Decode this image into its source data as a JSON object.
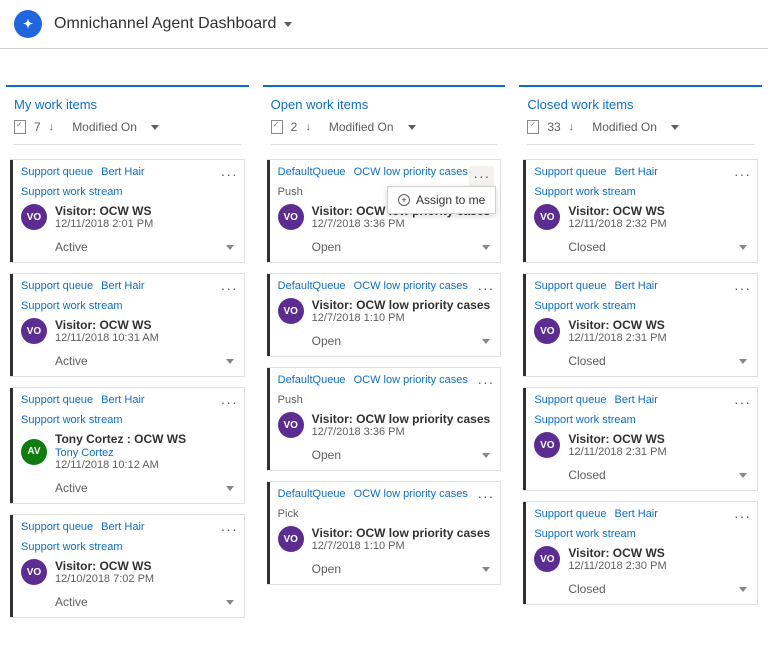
{
  "header": {
    "icon_glyph": "✦",
    "title": "Omnichannel Agent Dashboard"
  },
  "columns": [
    {
      "title": "My work items",
      "count": "7",
      "sort": "Modified On",
      "cards": [
        {
          "tags": [
            {
              "text": "Support queue",
              "kind": "link"
            },
            {
              "text": "Bert Hair",
              "kind": "link"
            },
            {
              "text": "Support work stream",
              "kind": "link"
            }
          ],
          "avatar": {
            "text": "VO",
            "cls": "av-vo"
          },
          "title": "Visitor: OCW WS",
          "date": "12/11/2018 2:01 PM",
          "status": "Active"
        },
        {
          "tags": [
            {
              "text": "Support queue",
              "kind": "link"
            },
            {
              "text": "Bert Hair",
              "kind": "link"
            },
            {
              "text": "Support work stream",
              "kind": "link"
            }
          ],
          "avatar": {
            "text": "VO",
            "cls": "av-vo"
          },
          "title": "Visitor: OCW WS",
          "date": "12/11/2018 10:31 AM",
          "status": "Active"
        },
        {
          "tags": [
            {
              "text": "Support queue",
              "kind": "link"
            },
            {
              "text": "Bert Hair",
              "kind": "link"
            },
            {
              "text": "Support work stream",
              "kind": "link"
            }
          ],
          "avatar": {
            "text": "AV",
            "cls": "av-av"
          },
          "title": "Tony Cortez : OCW WS",
          "sublink": "Tony Cortez",
          "date": "12/11/2018 10:12 AM",
          "status": "Active"
        },
        {
          "tags": [
            {
              "text": "Support queue",
              "kind": "link"
            },
            {
              "text": "Bert Hair",
              "kind": "link"
            },
            {
              "text": "Support work stream",
              "kind": "link"
            }
          ],
          "avatar": {
            "text": "VO",
            "cls": "av-vo"
          },
          "title": "Visitor: OCW WS",
          "date": "12/10/2018 7:02 PM",
          "status": "Active"
        }
      ]
    },
    {
      "title": "Open work items",
      "count": "2",
      "sort": "Modified On",
      "cards": [
        {
          "tags": [
            {
              "text": "DefaultQueue",
              "kind": "link"
            },
            {
              "text": "OCW low priority cases",
              "kind": "link"
            },
            {
              "text": "Push",
              "kind": "muted"
            }
          ],
          "avatar": {
            "text": "VO",
            "cls": "av-vo"
          },
          "title": "Visitor: OCW low priority cases",
          "date": "12/7/2018 3:36 PM",
          "status": "Open",
          "more_active": true,
          "popup": "Assign to me"
        },
        {
          "tags": [
            {
              "text": "DefaultQueue",
              "kind": "link"
            },
            {
              "text": "OCW low priority cases",
              "kind": "link"
            }
          ],
          "avatar": {
            "text": "VO",
            "cls": "av-vo"
          },
          "title": "Visitor: OCW low priority cases",
          "date": "12/7/2018 1:10 PM",
          "status": "Open"
        },
        {
          "tags": [
            {
              "text": "DefaultQueue",
              "kind": "link"
            },
            {
              "text": "OCW low priority cases",
              "kind": "link"
            },
            {
              "text": "Push",
              "kind": "muted"
            }
          ],
          "avatar": {
            "text": "VO",
            "cls": "av-vo"
          },
          "title": "Visitor: OCW low priority cases",
          "date": "12/7/2018 3:36 PM",
          "status": "Open"
        },
        {
          "tags": [
            {
              "text": "DefaultQueue",
              "kind": "link"
            },
            {
              "text": "OCW low priority cases",
              "kind": "link"
            },
            {
              "text": "Pick",
              "kind": "muted"
            }
          ],
          "avatar": {
            "text": "VO",
            "cls": "av-vo"
          },
          "title": "Visitor: OCW low priority cases",
          "date": "12/7/2018 1:10 PM",
          "status": "Open"
        }
      ]
    },
    {
      "title": "Closed work items",
      "count": "33",
      "sort": "Modified On",
      "cards": [
        {
          "tags": [
            {
              "text": "Support queue",
              "kind": "link"
            },
            {
              "text": "Bert Hair",
              "kind": "link"
            },
            {
              "text": "Support work stream",
              "kind": "link"
            }
          ],
          "avatar": {
            "text": "VO",
            "cls": "av-vo"
          },
          "title": "Visitor: OCW WS",
          "date": "12/11/2018 2:32 PM",
          "status": "Closed"
        },
        {
          "tags": [
            {
              "text": "Support queue",
              "kind": "link"
            },
            {
              "text": "Bert Hair",
              "kind": "link"
            },
            {
              "text": "Support work stream",
              "kind": "link"
            }
          ],
          "avatar": {
            "text": "VO",
            "cls": "av-vo"
          },
          "title": "Visitor: OCW WS",
          "date": "12/11/2018 2:31 PM",
          "status": "Closed"
        },
        {
          "tags": [
            {
              "text": "Support queue",
              "kind": "link"
            },
            {
              "text": "Bert Hair",
              "kind": "link"
            },
            {
              "text": "Support work stream",
              "kind": "link"
            }
          ],
          "avatar": {
            "text": "VO",
            "cls": "av-vo"
          },
          "title": "Visitor: OCW WS",
          "date": "12/11/2018 2:31 PM",
          "status": "Closed"
        },
        {
          "tags": [
            {
              "text": "Support queue",
              "kind": "link"
            },
            {
              "text": "Bert Hair",
              "kind": "link"
            },
            {
              "text": "Support work stream",
              "kind": "link"
            }
          ],
          "avatar": {
            "text": "VO",
            "cls": "av-vo"
          },
          "title": "Visitor: OCW WS",
          "date": "12/11/2018 2:30 PM",
          "status": "Closed"
        }
      ]
    }
  ]
}
